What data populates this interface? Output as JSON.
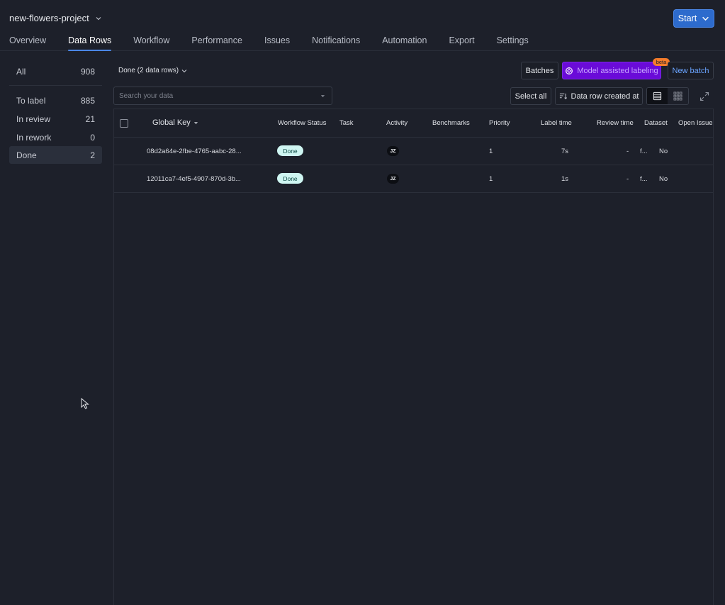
{
  "header": {
    "project_name": "new-flowers-project",
    "start_label": "Start"
  },
  "tabs": [
    {
      "label": "Overview"
    },
    {
      "label": "Data Rows",
      "active": true
    },
    {
      "label": "Workflow"
    },
    {
      "label": "Performance"
    },
    {
      "label": "Issues"
    },
    {
      "label": "Notifications"
    },
    {
      "label": "Automation"
    },
    {
      "label": "Export"
    },
    {
      "label": "Settings"
    }
  ],
  "sidebar": {
    "items": [
      {
        "label": "All",
        "count": "908"
      },
      {
        "label": "To label",
        "count": "885"
      },
      {
        "label": "In review",
        "count": "21"
      },
      {
        "label": "In rework",
        "count": "0"
      },
      {
        "label": "Done",
        "count": "2",
        "active": true
      }
    ]
  },
  "toolbar": {
    "filter_title": "Done (2 data rows)",
    "batches_label": "Batches",
    "mal_label": "Model assisted labeling",
    "beta_label": "beta",
    "new_batch_label": "New batch",
    "search_placeholder": "Search your data",
    "select_all_label": "Select all",
    "sort_label": "Data row created at"
  },
  "table": {
    "columns": [
      "Global Key",
      "Workflow Status",
      "Task",
      "Activity",
      "Benchmarks",
      "Priority",
      "Label time",
      "Review time",
      "Dataset",
      "Open Issues"
    ],
    "rows": [
      {
        "global_key": "08d2a64e-2fbe-4765-aabc-28...",
        "status": "Done",
        "activity": "JZ",
        "priority": "1",
        "label_time": "7s",
        "review_time": "-",
        "dataset": "f...",
        "open_issues": "No"
      },
      {
        "global_key": "12011ca7-4ef5-4907-870d-3b...",
        "status": "Done",
        "activity": "JZ",
        "priority": "1",
        "label_time": "1s",
        "review_time": "-",
        "dataset": "f...",
        "open_issues": "No"
      }
    ]
  },
  "colors": {
    "background": "#1d202a",
    "accent_blue": "#2d6bcd",
    "mal_purple": "#6a0bd8",
    "beta_orange": "#f47c2b",
    "done_pill": "#cff6f2"
  }
}
